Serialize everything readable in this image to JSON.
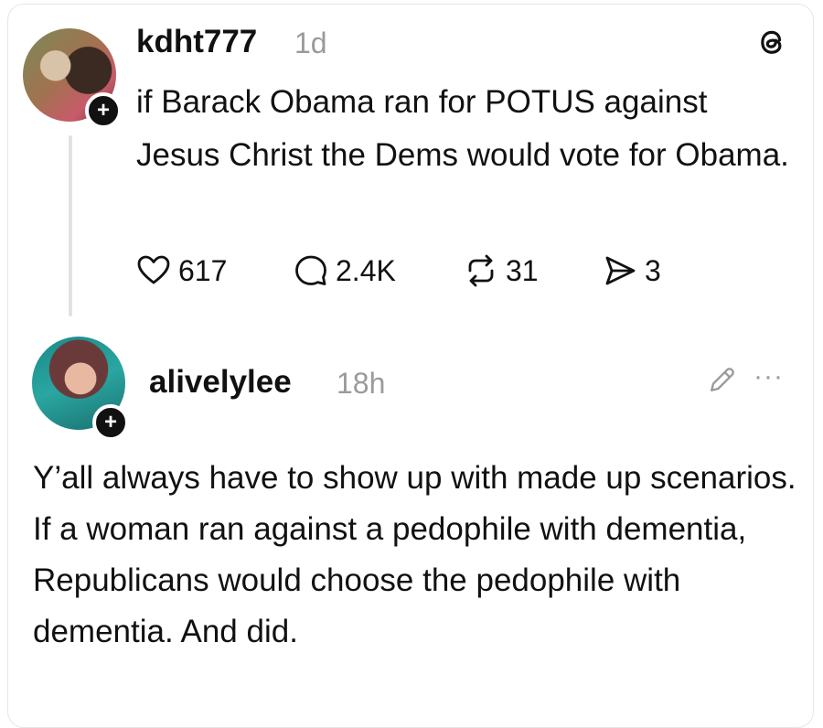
{
  "post": {
    "username": "kdht777",
    "time": "1d",
    "text": "if Barack Obama ran for POTUS against Jesus Christ the Dems would vote for Obama.",
    "actions": {
      "likes": "617",
      "replies": "2.4K",
      "reposts": "31",
      "shares": "3"
    }
  },
  "reply": {
    "username": "alivelylee",
    "time": "18h",
    "text": "Y’all always have to show up with made up scenarios. If a woman ran against a pedophile with dementia, Republicans would choose the pedophile with dementia. And did."
  },
  "icons": {
    "logo": "threads-logo-icon",
    "like": "heart-icon",
    "reply": "comment-icon",
    "repost": "repost-icon",
    "share": "send-icon",
    "edit": "pencil-icon",
    "more": "more-icon",
    "follow": "plus-icon"
  },
  "badge_symbol": "+",
  "more_symbol": "···"
}
